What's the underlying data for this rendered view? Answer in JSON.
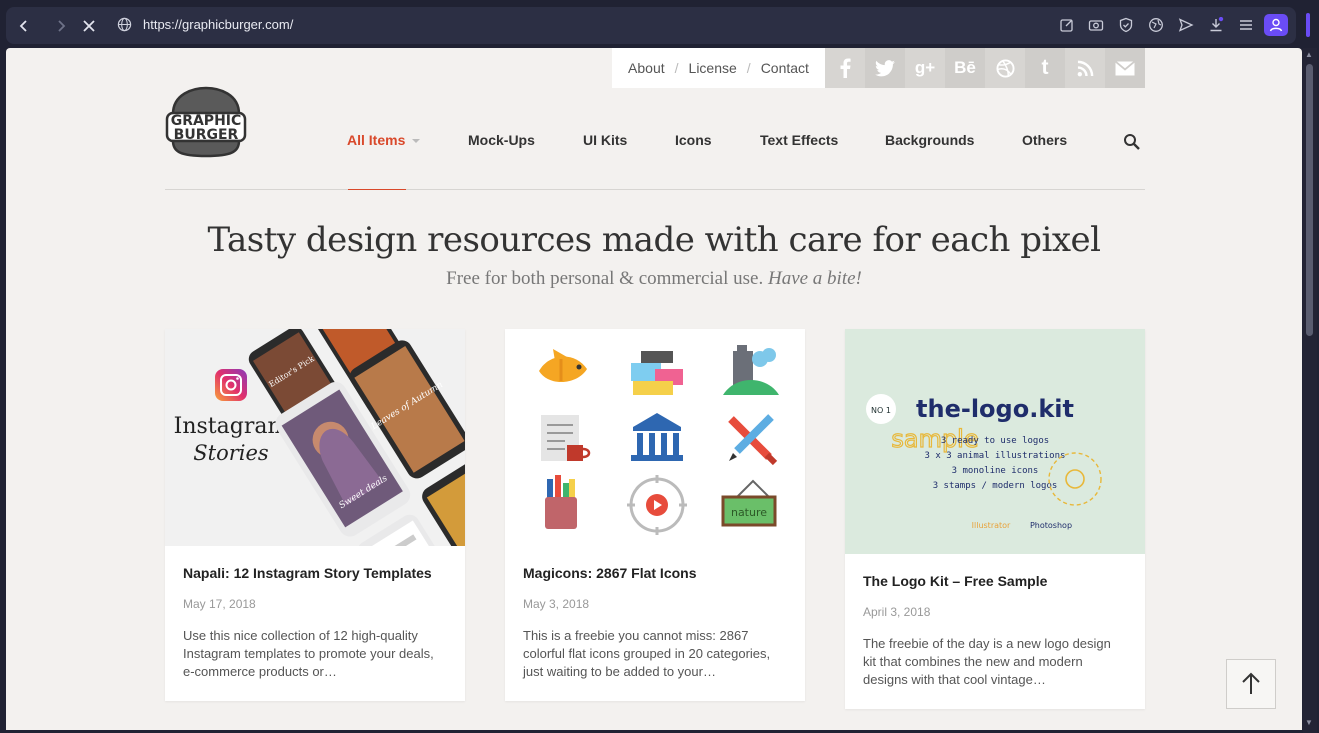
{
  "browser": {
    "url": "https://graphicburger.com/",
    "back_icon": "chevron-left-icon",
    "forward_icon": "chevron-right-icon",
    "stop_icon": "close-icon"
  },
  "toplinks": {
    "about": "About",
    "license": "License",
    "contact": "Contact",
    "separator": "/"
  },
  "social": [
    {
      "name": "facebook-icon",
      "glyph": "f",
      "color": "#cfcdca"
    },
    {
      "name": "twitter-icon",
      "glyph": "🐦",
      "color": "#cfcdca"
    },
    {
      "name": "googleplus-icon",
      "glyph": "g+",
      "color": "#cfcdca"
    },
    {
      "name": "behance-icon",
      "glyph": "Bē",
      "color": "#cfcdca"
    },
    {
      "name": "dribbble-icon",
      "glyph": "◎",
      "color": "#cfcdca"
    },
    {
      "name": "tumblr-icon",
      "glyph": "t",
      "color": "#cfcdca"
    },
    {
      "name": "rss-icon",
      "glyph": "◗",
      "color": "#cfcdca"
    },
    {
      "name": "mail-icon",
      "glyph": "✉",
      "color": "#cfcdca"
    }
  ],
  "logo": {
    "line1": "GRAPHIC",
    "line2": "BURGER"
  },
  "nav": {
    "all_items": "All Items",
    "mockups": "Mock-Ups",
    "ui_kits": "UI Kits",
    "icons": "Icons",
    "text_effects": "Text Effects",
    "backgrounds": "Backgrounds",
    "others": "Others"
  },
  "hero": {
    "title": "Tasty design resources made with care for each pixel",
    "subtitle": "Free for both personal & commercial use.",
    "subtitle_em": "Have a bite!"
  },
  "cards": [
    {
      "title": "Napali: 12 Instagram Story Templates",
      "date": "May 17, 2018",
      "excerpt": "Use this nice collection of 12 high-quality Instagram templates to promote your deals, e-commerce products or…",
      "thumb": {
        "line1": "Instagram",
        "line2": "Stories",
        "phone1": "Editor's Pick",
        "phone2": "Sweet deals",
        "phone3": "Leaves of Autumn"
      }
    },
    {
      "title": "Magicons: 2867 Flat Icons",
      "date": "May 3, 2018",
      "excerpt": "This is a freebie you cannot miss: 2867 colorful flat icons grouped in 20 categories, just waiting to be added to your…",
      "thumb": {
        "sign": "nature"
      }
    },
    {
      "title": "The Logo Kit – Free Sample",
      "date": "April 3, 2018",
      "excerpt": "The freebie of the day is a new logo design kit that combines the new and modern designs with that cool vintage…",
      "thumb": {
        "badge": "NO 1",
        "name": "the-logo.kit",
        "sample": "sample",
        "lines": [
          "3 ready to use logos",
          "3 x 3 animal illustrations",
          "3 monoline icons",
          "3 stamps / modern logos"
        ],
        "footer": [
          "Illustrator",
          "Photoshop"
        ]
      }
    }
  ],
  "colors": {
    "accent": "#d9492b",
    "page_bg": "#f3f1ef",
    "chrome_bg": "#202233",
    "profile": "#6a4cf5"
  }
}
